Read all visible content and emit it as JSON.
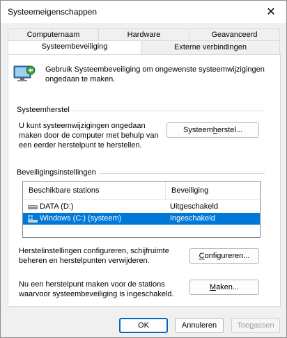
{
  "window": {
    "title": "Systeemeigenschappen",
    "close_glyph": "✕"
  },
  "tabs": {
    "row1": [
      "Computernaam",
      "Hardware",
      "Geavanceerd"
    ],
    "row2": [
      "Systeembeveiliging",
      "Externe verbindingen"
    ],
    "active": "Systeembeveiliging"
  },
  "intro": {
    "icon": "system-protection-icon",
    "text": "Gebruik Systeembeveiliging om ongewenste systeemwijzigingen ongedaan te maken."
  },
  "restore": {
    "group_title": "Systeemherstel",
    "description": "U kunt systeemwijzigingen ongedaan maken door de computer met behulp van een eerder herstelpunt te herstellen.",
    "button_pre": "Systeem",
    "button_accel": "h",
    "button_post": "erstel..."
  },
  "protection": {
    "group_title": "Beveiligingsinstellingen",
    "columns": [
      "Beschikbare stations",
      "Beveiliging"
    ],
    "rows": [
      {
        "drive": "DATA (D:)",
        "status": "Uitgeschakeld",
        "icon": "drive-icon",
        "selected": false
      },
      {
        "drive": "Windows (C:) (systeem)",
        "status": "Ingeschakeld",
        "icon": "system-drive-icon",
        "selected": true
      }
    ],
    "configure_text": "Herstelinstellingen configureren, schijfruimte beheren en herstelpunten verwijderen.",
    "configure_pre": "",
    "configure_accel": "C",
    "configure_post": "onfigureren...",
    "create_text": "Nu een herstelpunt maken voor de stations waarvoor systeembeveiliging is ingeschakeld.",
    "create_pre": "",
    "create_accel": "M",
    "create_post": "aken..."
  },
  "footer": {
    "ok": "OK",
    "cancel": "Annuleren",
    "apply_pre": "Toe",
    "apply_accel": "p",
    "apply_post": "assen"
  },
  "colors": {
    "selection": "#0078d7",
    "primary_border": "#0067c0"
  }
}
